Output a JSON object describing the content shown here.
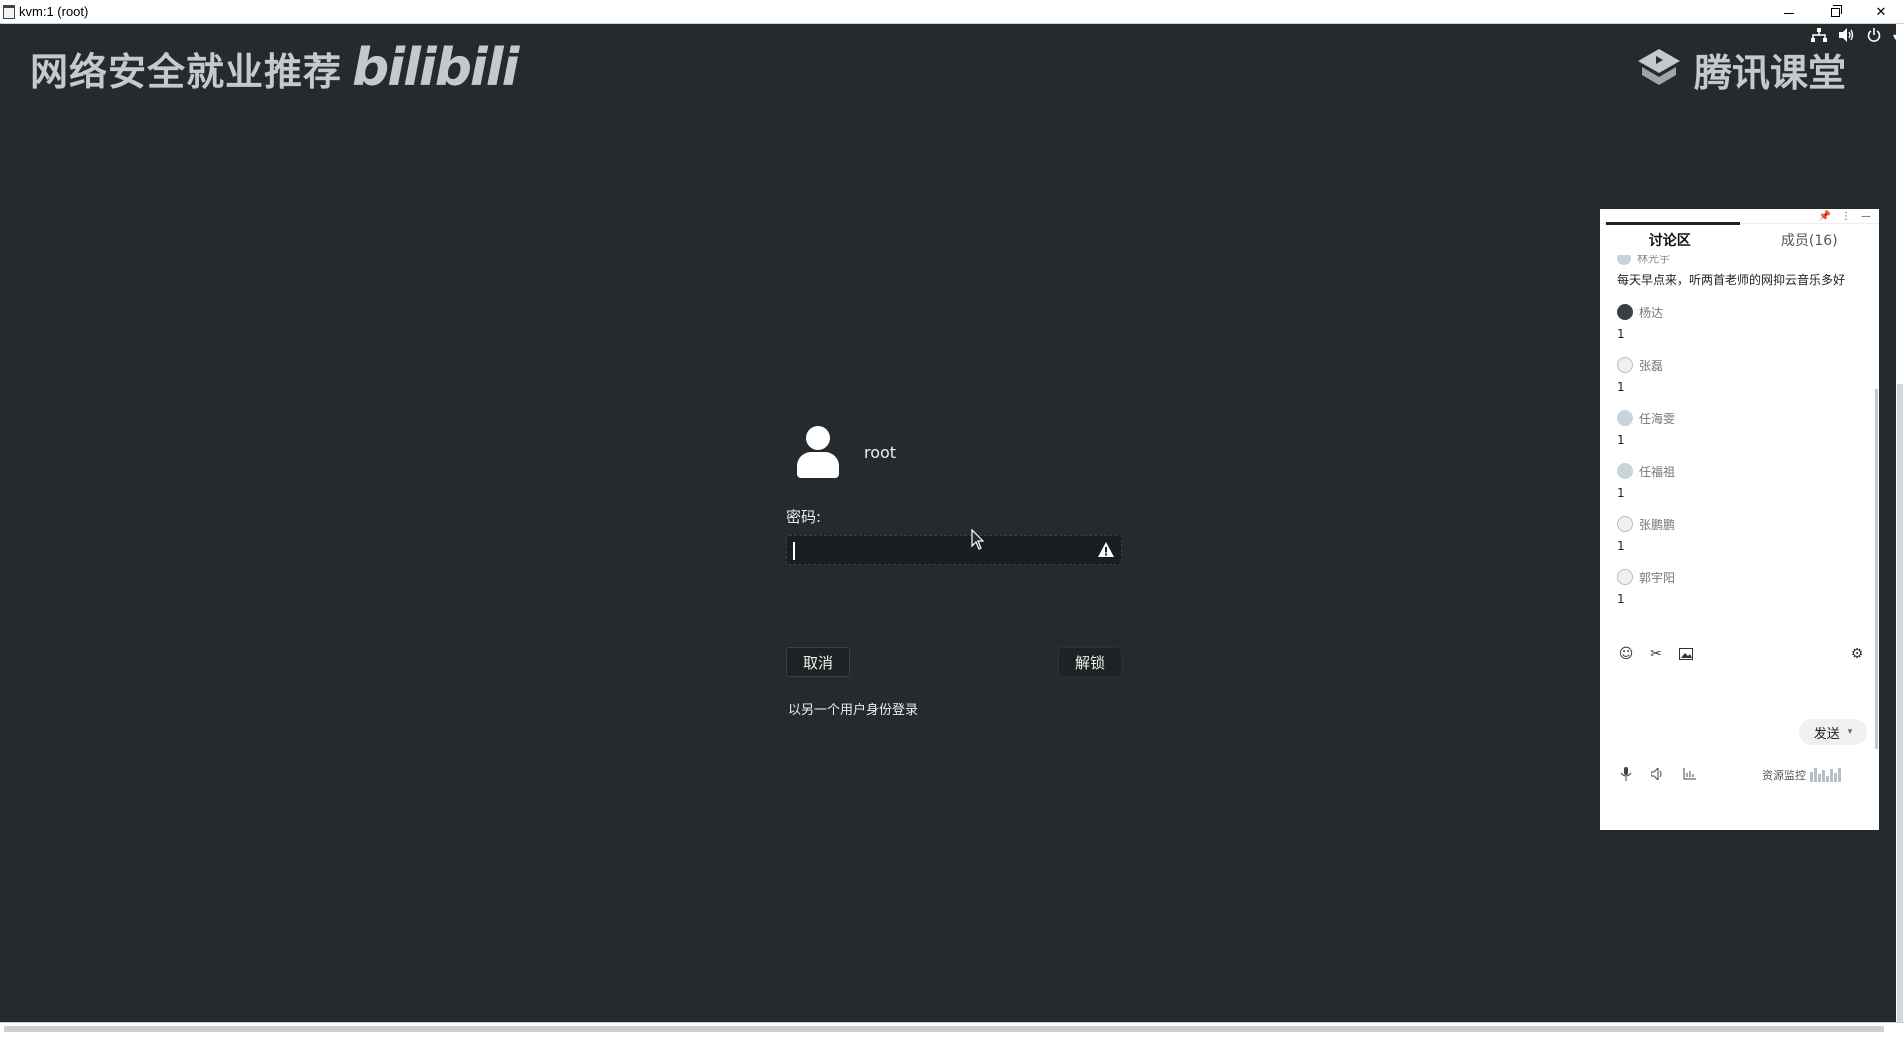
{
  "window": {
    "title": "kvm:1 (root)"
  },
  "watermark": {
    "left_text": "网络安全就业推荐",
    "left_brand": "bilibili",
    "right_text": "腾讯课堂"
  },
  "status_icons": [
    "network-icon",
    "volume-icon",
    "power-icon",
    "chevron-down-icon"
  ],
  "unlock": {
    "username": "root",
    "password_label": "密码:",
    "password_value": "",
    "cancel_label": "取消",
    "unlock_label": "解锁",
    "switch_user_label": "以另一个用户身份登录"
  },
  "chat": {
    "tabs": [
      {
        "label": "讨论区",
        "active": true
      },
      {
        "label": "成员(16)",
        "active": false
      }
    ],
    "partial_message": {
      "name": "林光宇",
      "text": "每天早点来，听两首老师的网抑云音乐多好"
    },
    "messages": [
      {
        "name": "杨达",
        "text": "1",
        "avatar": "dark"
      },
      {
        "name": "张磊",
        "text": "1",
        "avatar": "sketch"
      },
      {
        "name": "任海雯",
        "text": "1",
        "avatar": "default"
      },
      {
        "name": "任福祖",
        "text": "1",
        "avatar": "default"
      },
      {
        "name": "张鹏鹏",
        "text": "1",
        "avatar": "sketch"
      },
      {
        "name": "郭宇阳",
        "text": "1",
        "avatar": "sketch"
      }
    ],
    "toolbar_icons": [
      "emoji-icon",
      "scissors-icon",
      "image-icon",
      "settings-icon"
    ],
    "send_label": "发送",
    "bottom_icons": [
      "microphone-icon",
      "speaker-icon",
      "stats-icon"
    ],
    "resource_label": "资源监控"
  }
}
